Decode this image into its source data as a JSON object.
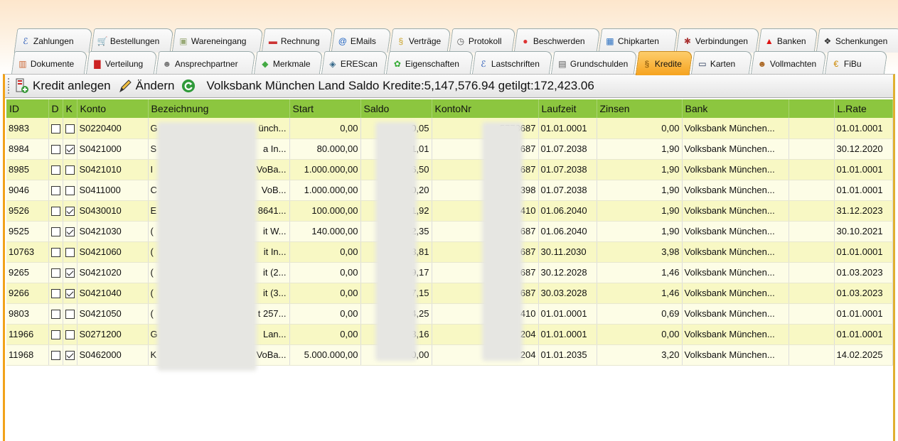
{
  "tabs_row1": [
    {
      "label": "Zahlungen",
      "icon": "payment-icon"
    },
    {
      "label": "Bestellungen",
      "icon": "cart-icon"
    },
    {
      "label": "Wareneingang",
      "icon": "goods-icon"
    },
    {
      "label": "Rechnung",
      "icon": "invoice-icon"
    },
    {
      "label": "EMails",
      "icon": "at-icon"
    },
    {
      "label": "Verträge",
      "icon": "contract-icon"
    },
    {
      "label": "Protokoll",
      "icon": "clock-icon"
    },
    {
      "label": "Beschwerden",
      "icon": "complaint-icon"
    },
    {
      "label": "Chipkarten",
      "icon": "chipcard-icon"
    },
    {
      "label": "Verbindungen",
      "icon": "network-icon"
    },
    {
      "label": "Banken",
      "icon": "bank-icon"
    },
    {
      "label": "Schenkungen",
      "icon": "gift-icon"
    }
  ],
  "tabs_row2": [
    {
      "label": "Dokumente",
      "icon": "documents-icon"
    },
    {
      "label": "Verteilung",
      "icon": "distribution-icon"
    },
    {
      "label": "Ansprechpartner",
      "icon": "contacts-icon"
    },
    {
      "label": "Merkmale",
      "icon": "cube-icon"
    },
    {
      "label": "EREScan",
      "icon": "scan-icon"
    },
    {
      "label": "Eigenschaften",
      "icon": "properties-icon"
    },
    {
      "label": "Lastschriften",
      "icon": "debit-icon"
    },
    {
      "label": "Grundschulden",
      "icon": "land-charge-icon"
    },
    {
      "label": "Kredite",
      "icon": "paragraph-icon",
      "active": true
    },
    {
      "label": "Karten",
      "icon": "card-icon"
    },
    {
      "label": "Vollmachten",
      "icon": "power-of-attorney-icon"
    },
    {
      "label": "FiBu",
      "icon": "euro-icon"
    }
  ],
  "toolbar": {
    "create_label": "Kredit anlegen",
    "edit_label": "Ändern",
    "status": "Volksbank München Land Saldo Kredite:5,147,576.94 getilgt:172,423.06"
  },
  "columns": [
    "ID",
    "D",
    "K",
    "Konto",
    "Bezeichnung",
    "Start",
    "Saldo",
    "KontoNr",
    "Laufzeit",
    "Zinsen",
    "Bank",
    "",
    "L.Rate"
  ],
  "rows": [
    {
      "id": "8983",
      "d": false,
      "k": false,
      "konto": "S0220400",
      "bez_start": "G",
      "bez_end": "ünch...",
      "start": "0,00",
      "saldo": "0,05",
      "kontonr": "5773687",
      "laufzeit": "01.01.0001",
      "zinsen": "0,00",
      "bank": "Volksbank München...",
      "extra": "",
      "lrate": "01.01.0001"
    },
    {
      "id": "8984",
      "d": false,
      "k": true,
      "konto": "S0421000",
      "bez_start": "S",
      "bez_end": "a In...",
      "start": "80.000,00",
      "saldo": "1,01",
      "kontonr": "687",
      "laufzeit": "01.07.2038",
      "zinsen": "1,90",
      "bank": "Volksbank München...",
      "extra": "",
      "lrate": "30.12.2020"
    },
    {
      "id": "8985",
      "d": false,
      "k": false,
      "konto": "S0421010",
      "bez_start": "I",
      "bez_end": "VoBa...",
      "start": "1.000.000,00",
      "saldo": "6,50",
      "kontonr": "687",
      "laufzeit": "01.07.2038",
      "zinsen": "1,90",
      "bank": "Volksbank München...",
      "extra": "",
      "lrate": "01.01.0001"
    },
    {
      "id": "9046",
      "d": false,
      "k": false,
      "konto": "S0411000",
      "bez_start": "C",
      "bez_end": "VoB...",
      "start": "1.000.000,00",
      "saldo": "0,20",
      "kontonr": "398",
      "laufzeit": "01.07.2038",
      "zinsen": "1,90",
      "bank": "Volksbank München...",
      "extra": "",
      "lrate": "01.01.0001"
    },
    {
      "id": "9526",
      "d": false,
      "k": true,
      "konto": "S0430010",
      "bez_start": "E",
      "bez_end": "8641...",
      "start": "100.000,00",
      "saldo": "1,92",
      "kontonr": "410",
      "laufzeit": "01.06.2040",
      "zinsen": "1,90",
      "bank": "Volksbank München...",
      "extra": "",
      "lrate": "31.12.2023"
    },
    {
      "id": "9525",
      "d": false,
      "k": true,
      "konto": "S0421030",
      "bez_start": "(",
      "bez_end": "it W...",
      "start": "140.000,00",
      "saldo": "2,35",
      "kontonr": "687",
      "laufzeit": "01.06.2040",
      "zinsen": "1,90",
      "bank": "Volksbank München...",
      "extra": "",
      "lrate": "30.10.2021"
    },
    {
      "id": "10763",
      "d": false,
      "k": false,
      "konto": "S0421060",
      "bez_start": "(",
      "bez_end": "it In...",
      "start": "0,00",
      "saldo": "3,81",
      "kontonr": "687",
      "laufzeit": "30.11.2030",
      "zinsen": "3,98",
      "bank": "Volksbank München...",
      "extra": "",
      "lrate": "01.01.0001"
    },
    {
      "id": "9265",
      "d": false,
      "k": true,
      "konto": "S0421020",
      "bez_start": "(",
      "bez_end": "it (2...",
      "start": "0,00",
      "saldo": "9,17",
      "kontonr": "687",
      "laufzeit": "30.12.2028",
      "zinsen": "1,46",
      "bank": "Volksbank München...",
      "extra": "",
      "lrate": "01.03.2023"
    },
    {
      "id": "9266",
      "d": false,
      "k": true,
      "konto": "S0421040",
      "bez_start": "(",
      "bez_end": "it (3...",
      "start": "0,00",
      "saldo": "7,15",
      "kontonr": "687",
      "laufzeit": "30.03.2028",
      "zinsen": "1,46",
      "bank": "Volksbank München...",
      "extra": "",
      "lrate": "01.03.2023"
    },
    {
      "id": "9803",
      "d": false,
      "k": false,
      "konto": "S0421050",
      "bez_start": "(",
      "bez_end": "t 257...",
      "start": "0,00",
      "saldo": "4,25",
      "kontonr": "410",
      "laufzeit": "01.01.0001",
      "zinsen": "0,69",
      "bank": "Volksbank München...",
      "extra": "",
      "lrate": "01.01.0001"
    },
    {
      "id": "11966",
      "d": false,
      "k": false,
      "konto": "S0271200",
      "bez_start": "G",
      "bez_end": "Lan...",
      "start": "0,00",
      "saldo": "3,16",
      "kontonr": "204",
      "laufzeit": "01.01.0001",
      "zinsen": "0,00",
      "bank": "Volksbank München...",
      "extra": "",
      "lrate": "01.01.0001"
    },
    {
      "id": "11968",
      "d": false,
      "k": true,
      "konto": "S0462000",
      "bez_start": "K",
      "bez_end": "VoBa...",
      "start": "5.000.000,00",
      "saldo": "0,00",
      "kontonr": "204",
      "laufzeit": "01.01.2035",
      "zinsen": "3,20",
      "bank": "Volksbank München...",
      "extra": "",
      "lrate": "14.02.2025"
    }
  ],
  "colors": {
    "header_green": "#8cc63f",
    "row_odd": "#f8f8c4",
    "row_even": "#fdfde6",
    "active_tab": "#f6a31f"
  }
}
